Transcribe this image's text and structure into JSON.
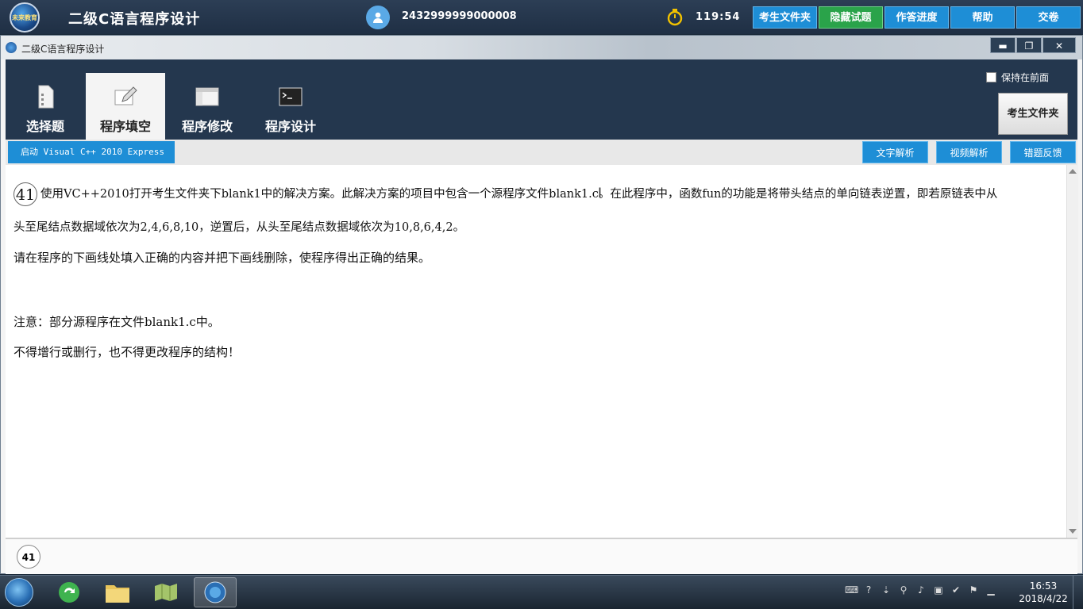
{
  "topbar": {
    "title": "二级C语言程序设计",
    "logo_text": "未来教育",
    "user_id": "2432999999000008",
    "timer": "119:54",
    "buttons": [
      "考生文件夹",
      "隐藏试题",
      "作答进度",
      "帮助",
      "交卷"
    ]
  },
  "window": {
    "title": "二级C语言程序设计",
    "controls": [
      "▬",
      "❐",
      "✕"
    ]
  },
  "tabs": [
    {
      "label": "选择题",
      "icon": "document-icon"
    },
    {
      "label": "程序填空",
      "icon": "edit-icon"
    },
    {
      "label": "程序修改",
      "icon": "window-icon"
    },
    {
      "label": "程序设计",
      "icon": "terminal-icon"
    }
  ],
  "active_tab": 1,
  "keep_front_label": "保持在前面",
  "folder_button": "考生文件夹",
  "launch_button": "启动 Visual C++ 2010 Express",
  "sub_buttons": [
    "文字解析",
    "视频解析",
    "错题反馈"
  ],
  "question": {
    "number": "41",
    "line1": "使用VC++2010打开考生文件夹下blank1中的解决方案。此解决方案的项目中包含一个源程序文件blank1.c。在此程序中，函数fun的功能是将带头结点的单向链表逆置，即若原链表中从",
    "line2": "头至尾结点数据域依次为2,4,6,8,10，逆置后，从头至尾结点数据域依次为10,8,6,4,2。",
    "line3": "请在程序的下画线处填入正确的内容并把下画线删除，使程序得出正确的结果。",
    "note1": "注意：部分源程序在文件blank1.c中。",
    "note2": "不得增行或删行，也不得更改程序的结构！"
  },
  "bottom_badge": "41",
  "taskbar": {
    "time": "16:53",
    "date": "2018/4/22"
  },
  "colors": {
    "accent_blue": "#1e8ed6",
    "accent_green": "#2aa34a",
    "ribbon": "#24374e"
  }
}
